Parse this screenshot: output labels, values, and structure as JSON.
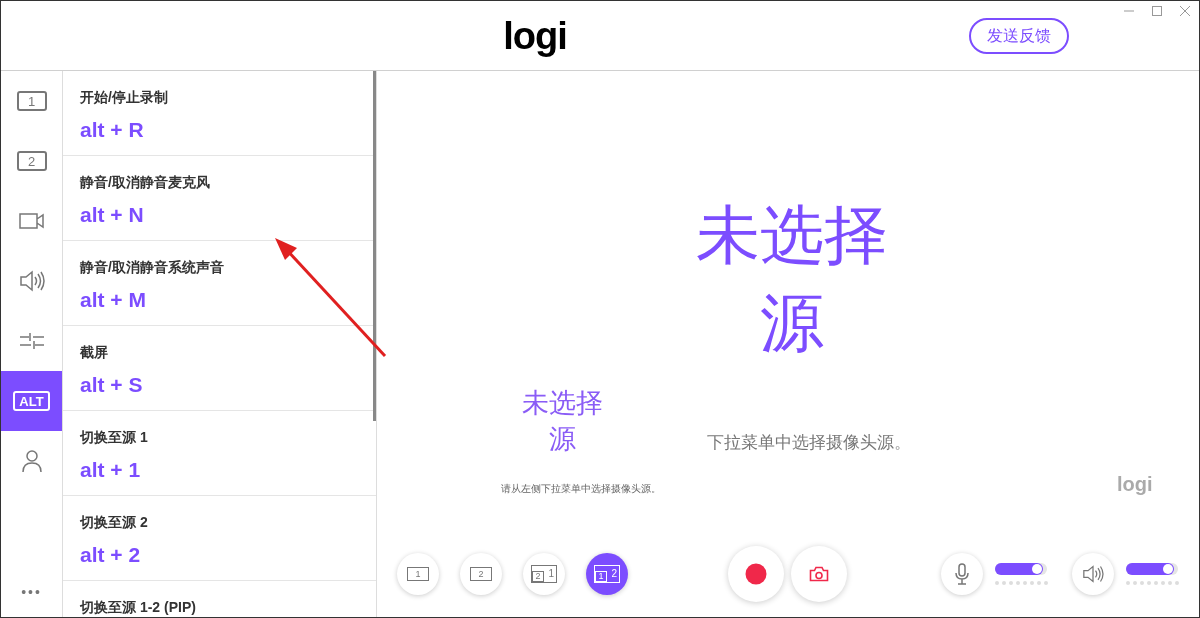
{
  "header": {
    "logo": "logi",
    "feedback_button": "发送反馈"
  },
  "rail": {
    "items": [
      {
        "kind": "source",
        "label": "1",
        "selected": false
      },
      {
        "kind": "source",
        "label": "2",
        "selected": false
      },
      {
        "kind": "camera",
        "selected": false
      },
      {
        "kind": "speaker",
        "selected": false
      },
      {
        "kind": "adjust",
        "selected": false
      },
      {
        "kind": "source",
        "label": "ALT",
        "selected": true
      },
      {
        "kind": "person",
        "selected": false
      }
    ],
    "more": "•••"
  },
  "shortcuts": [
    {
      "action": "开始/停止录制",
      "keys": "alt + R"
    },
    {
      "action": "静音/取消静音麦克风",
      "keys": "alt + N"
    },
    {
      "action": "静音/取消静音系统声音",
      "keys": "alt + M"
    },
    {
      "action": "截屏",
      "keys": "alt + S"
    },
    {
      "action": "切换至源 1",
      "keys": "alt + 1"
    },
    {
      "action": "切换至源 2",
      "keys": "alt + 2"
    },
    {
      "action": "切换至源 1-2 (PIP)"
    }
  ],
  "preview": {
    "message": "未选择源",
    "message_ghost": "未选择源",
    "hint_small": "请从左侧下拉菜单中选择摄像头源。",
    "hint_partial": "下拉菜单中选择摄像头源。",
    "logo_ghost": "logi"
  },
  "layouts": [
    {
      "kind": "single",
      "main": "1",
      "selected": false
    },
    {
      "kind": "single",
      "main": "2",
      "selected": false
    },
    {
      "kind": "pip",
      "main": "1",
      "inset": "2",
      "selected": false
    },
    {
      "kind": "pip",
      "main": "2",
      "inset": "1",
      "selected": true
    }
  ],
  "mic": {
    "level": 0.92
  },
  "speaker": {
    "level": 0.92
  }
}
